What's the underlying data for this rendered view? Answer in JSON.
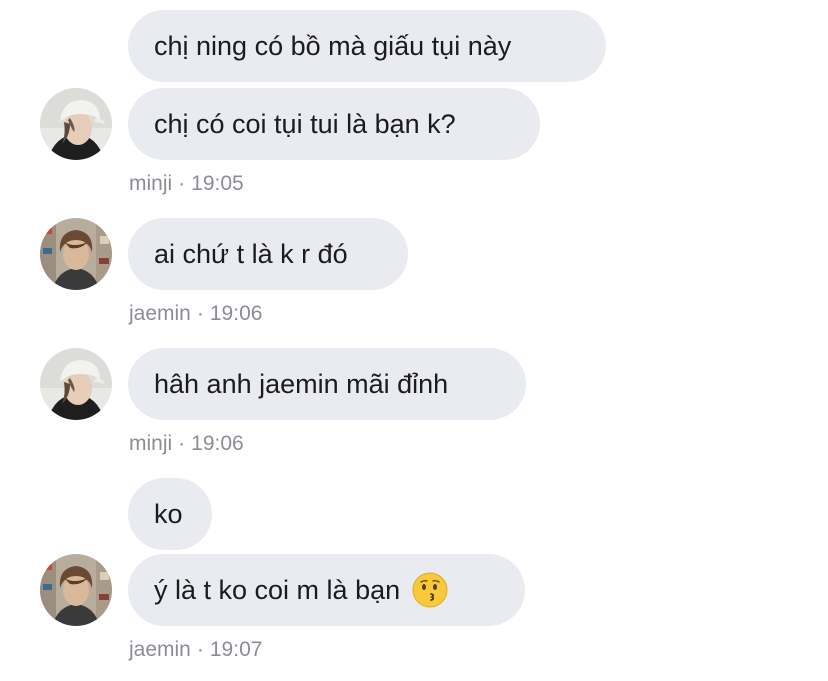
{
  "messages": [
    {
      "text": "chị ning có bồ mà giấu tụi này"
    },
    {
      "text": "chị có coi tụi tui là bạn k?"
    },
    {
      "text": "ai chứ t là k r đó"
    },
    {
      "text": "hâh anh jaemin mãi đỉnh"
    },
    {
      "text": "ko"
    },
    {
      "text": "ý là t ko coi m là bạn"
    }
  ],
  "groups": [
    {
      "sender": "minji",
      "time": "19:05",
      "avatar": "minji-avatar"
    },
    {
      "sender": "jaemin",
      "time": "19:06",
      "avatar": "jaemin-avatar"
    },
    {
      "sender": "minji",
      "time": "19:06",
      "avatar": "minji-avatar"
    },
    {
      "sender": "jaemin",
      "time": "19:07",
      "avatar": "jaemin-avatar"
    }
  ],
  "meta_separator": "·",
  "emoji": "kissing-face-emoji",
  "colors": {
    "bubble_bg": "#e9ebf0",
    "text": "#1c1c1e",
    "meta_text": "#8a8d93"
  }
}
